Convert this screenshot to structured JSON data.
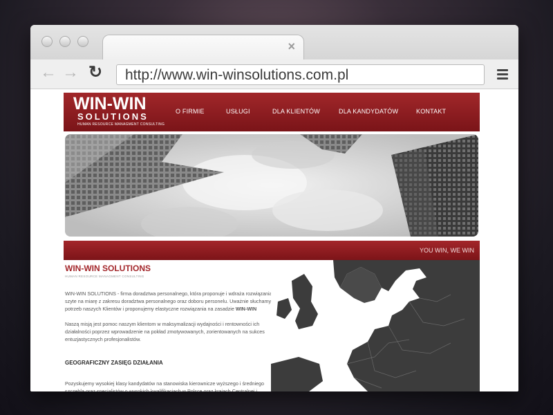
{
  "browser": {
    "url": "http://www.win-winsolutions.com.pl",
    "tab_close": "×",
    "icons": [
      "back-arrow-icon",
      "forward-arrow-icon",
      "reload-icon",
      "menu-icon",
      "close-icon"
    ]
  },
  "site": {
    "logo": {
      "main": "WIN-WIN",
      "sub": "SOLUTIONS",
      "tagline": "HUMAN RESOURCE MANAGMENT CONSULTING"
    },
    "nav": [
      {
        "label": "O FIRMIE"
      },
      {
        "label": "USŁUGI"
      },
      {
        "label": "DLA KLIENTÓW"
      },
      {
        "label": "DLA KANDYDATÓW"
      },
      {
        "label": "KONTAKT"
      }
    ],
    "slogan": "YOU WIN, WE WIN",
    "content": {
      "title": "WIN-WIN SOLUTIONS",
      "subtitle": "HUMAN RESOURCE MANAGMENT CONSULTING",
      "para1": "WIN-WIN SOLUTIONS - firma doradztwa personalnego, która proponuje i wdraża rozwiązania szyte na miarę z zakresu doradztwa personalnego oraz doboru personelu. Uważnie słuchamy potrzeb naszych Klientów i proponujemy elastyczne rozwiązania na zasadzie",
      "para1_bold": "WIN-WIN",
      "para2": "Naszą misją jest pomoc naszym klientom w maksymalizacji wydajności i rentowności ich działalności poprzez wprowadzenie na pokład zmotywowanych, zorientowanych na sukces entuzjastycznych profesjonalistów.",
      "heading": "GEOGRAFICZNY ZASIĘG DZIAŁANIA",
      "para3": "Pozyskujemy wysokiej klasy kandydatów na stanowiska kierownicze wyższego i średniego szczebla oraz specjalistów o wysokich kwalifikacjach w Polsce oraz krajach Centralnej i"
    }
  },
  "colors": {
    "brand_red": "#a1272a",
    "brand_red_dark": "#7a1418",
    "text": "#555555",
    "map": "#3c3c3c"
  }
}
